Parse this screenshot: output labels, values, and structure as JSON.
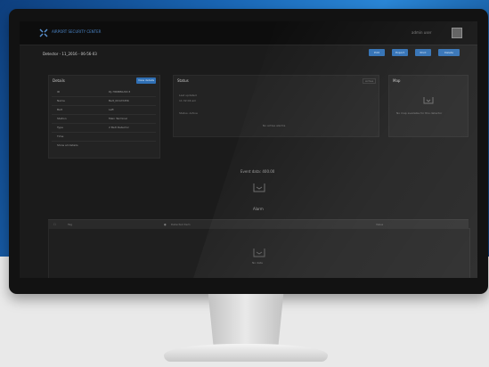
{
  "app": {
    "brand": "AIRPORT SECURITY CENTER",
    "user": "admin user"
  },
  "breadcrumb": "Detector - 11_2016 - 06-56-03",
  "actions": [
    "Edit",
    "Export",
    "Print",
    "Delete"
  ],
  "details": {
    "title": "Details",
    "button": "View details",
    "rows": [
      {
        "label": "ID",
        "value": "DJ-78DBB0A5C3"
      },
      {
        "label": "Name",
        "value": "Belt_00123456"
      },
      {
        "label": "Belt",
        "value": "Left"
      },
      {
        "label": "Station",
        "value": "Main Terminal"
      },
      {
        "label": "Type",
        "value": "2 Belt Detector"
      },
      {
        "label": "Time",
        "value": ""
      },
      {
        "label": "Show all details",
        "value": ""
      }
    ]
  },
  "status": {
    "title": "Status",
    "badge": "Active",
    "lines": [
      "Last updated",
      "11:32:04 am",
      "Status: Active",
      "No active alarms"
    ]
  },
  "map": {
    "title": "Map",
    "message": "No map available for this detector"
  },
  "lower": {
    "caption": "Event data: 400.00",
    "sub_caption": "Alarm"
  },
  "table": {
    "col1": "Tag",
    "col2": "Detected item",
    "col3": "Value",
    "empty": "No data"
  }
}
